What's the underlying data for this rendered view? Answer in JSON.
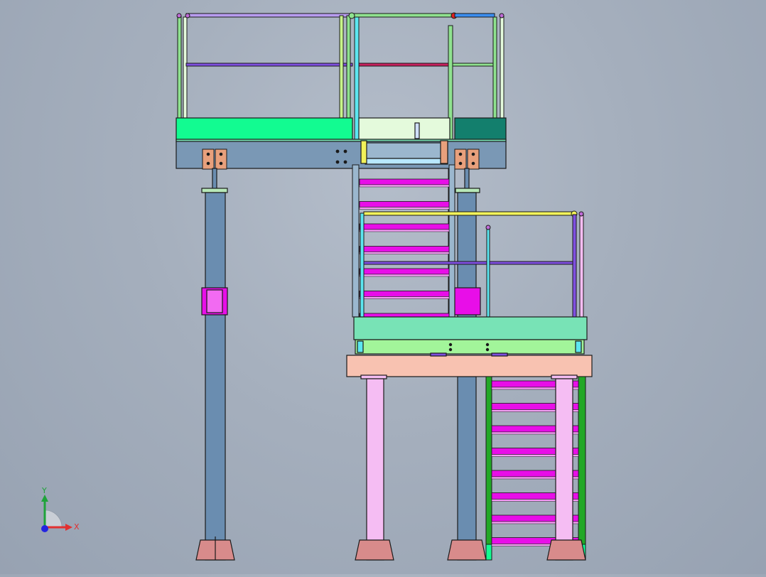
{
  "viewport": {
    "background": "#a5afbd",
    "palette": {
      "column_blue": "#6a8db0",
      "column_pink": "#f5bdf3",
      "deck_green": "#12fb91",
      "deck_teal": "#137f6d",
      "deck_light": "#e4fadc",
      "beam_blue": "#7a98b5",
      "beam_mint": "#78e3b6",
      "beam_lime": "#a2f59a",
      "beam_salmon": "#f8c2b1",
      "tread_magenta": "#e80ee8",
      "rail_purple": "#7f4fe0",
      "rail_yellow": "#f2f25a",
      "rail_green": "#8fe28f",
      "rail_cyan": "#5ce6f0",
      "rail_red": "#c8205e",
      "stringer_green": "#22a826",
      "plate_orange": "#e8a07c",
      "baseplate_rose": "#d88b8b",
      "outline": "#1a1a1a"
    }
  },
  "triad": {
    "x_label": "X",
    "y_label": "Y",
    "x_color": "#e23030",
    "y_color": "#1fa33a",
    "origin_color": "#2424e0"
  }
}
